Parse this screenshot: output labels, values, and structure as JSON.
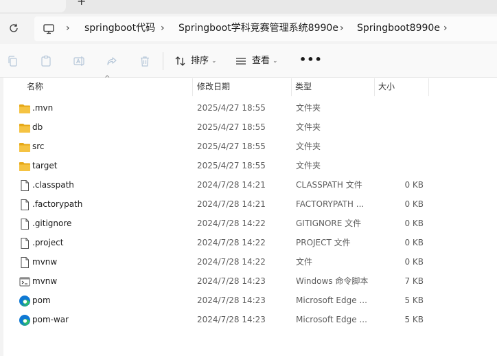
{
  "breadcrumb": [
    "springboot代码",
    "Springboot学科竞赛管理系统8990e",
    "Springboot8990e"
  ],
  "tabs": {
    "close": "×",
    "new": "+"
  },
  "toolbar": {
    "sort_label": "排序",
    "view_label": "查看",
    "more_label": "•••",
    "caret": "⌄"
  },
  "columns": {
    "name": "名称",
    "date": "修改日期",
    "type": "类型",
    "size": "大小",
    "sort_indicator": "^"
  },
  "files": [
    {
      "icon": "folder-icon",
      "name": ".mvn",
      "date": "2025/4/27 18:55",
      "type": "文件夹",
      "size": ""
    },
    {
      "icon": "folder-icon",
      "name": "db",
      "date": "2025/4/27 18:55",
      "type": "文件夹",
      "size": ""
    },
    {
      "icon": "folder-icon",
      "name": "src",
      "date": "2025/4/27 18:55",
      "type": "文件夹",
      "size": ""
    },
    {
      "icon": "folder-icon",
      "name": "target",
      "date": "2025/4/27 18:55",
      "type": "文件夹",
      "size": ""
    },
    {
      "icon": "file-icon",
      "name": ".classpath",
      "date": "2024/7/28 14:21",
      "type": "CLASSPATH 文件",
      "size": "0 KB"
    },
    {
      "icon": "file-icon",
      "name": ".factorypath",
      "date": "2024/7/28 14:21",
      "type": "FACTORYPATH ...",
      "size": "0 KB"
    },
    {
      "icon": "file-icon",
      "name": ".gitignore",
      "date": "2024/7/28 14:22",
      "type": "GITIGNORE 文件",
      "size": "0 KB"
    },
    {
      "icon": "file-icon",
      "name": ".project",
      "date": "2024/7/28 14:22",
      "type": "PROJECT 文件",
      "size": "0 KB"
    },
    {
      "icon": "file-icon",
      "name": "mvnw",
      "date": "2024/7/28 14:22",
      "type": "文件",
      "size": "0 KB"
    },
    {
      "icon": "cmd-script-icon",
      "name": "mvnw",
      "date": "2024/7/28 14:23",
      "type": "Windows 命令脚本",
      "size": "7 KB"
    },
    {
      "icon": "edge-icon",
      "name": "pom",
      "date": "2024/7/28 14:23",
      "type": "Microsoft Edge ...",
      "size": "5 KB"
    },
    {
      "icon": "edge-icon",
      "name": "pom-war",
      "date": "2024/7/28 14:23",
      "type": "Microsoft Edge ...",
      "size": "5 KB"
    }
  ],
  "colors": {
    "folder": "#f5c342",
    "folder_dark": "#e6a817",
    "edge_blue": "#0f78d4",
    "edge_green": "#2ebd6b"
  }
}
